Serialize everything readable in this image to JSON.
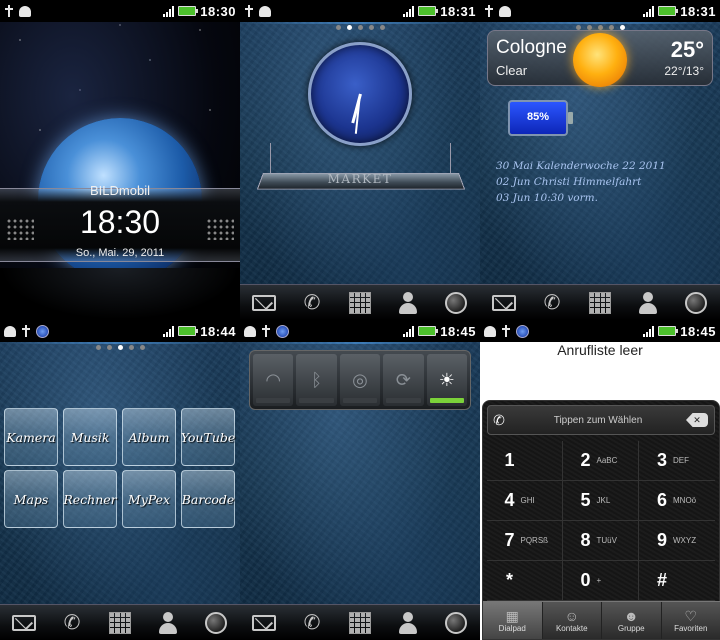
{
  "panels": {
    "lockscreen": {
      "time": "18:30",
      "carrier": "BILDmobil",
      "clock": "18:30",
      "date": "So., Mai. 29, 2011"
    },
    "home_clock": {
      "time": "18:31",
      "market_label": "MARKET"
    },
    "home_weather": {
      "time": "18:31",
      "weather": {
        "city": "Cologne",
        "condition": "Clear",
        "temp": "25°",
        "range": "22°/13°"
      },
      "battery": {
        "level": "85%",
        "fraction": 0.85
      },
      "calendar": [
        "30 Mai Kalenderwoche 22 2011",
        "02 Jun Christi Himmelfahrt",
        "03 Jun 10:30 vorm."
      ]
    },
    "home_apps": {
      "time": "18:44",
      "apps": [
        "Kamera",
        "Musik",
        "Album",
        "YouTube",
        "Maps",
        "Rechner",
        "MyPex",
        "Barcode"
      ]
    },
    "home_power": {
      "time": "18:45",
      "toggles": [
        "wifi",
        "bluetooth",
        "gps",
        "sync",
        "brightness"
      ],
      "active_toggle": "brightness"
    },
    "dialer": {
      "time": "18:45",
      "empty_text": "Anrufliste leer",
      "hint": "Tippen zum Wählen",
      "keys": [
        {
          "num": "1",
          "sub": ""
        },
        {
          "num": "2",
          "sub": "AaBC"
        },
        {
          "num": "3",
          "sub": "DEF"
        },
        {
          "num": "4",
          "sub": "GHI"
        },
        {
          "num": "5",
          "sub": "JKL"
        },
        {
          "num": "6",
          "sub": "MNOö"
        },
        {
          "num": "7",
          "sub": "PQRSß"
        },
        {
          "num": "8",
          "sub": "TUüV"
        },
        {
          "num": "9",
          "sub": "WXYZ"
        },
        {
          "num": "*",
          "sub": ""
        },
        {
          "num": "0",
          "sub": "+"
        },
        {
          "num": "#",
          "sub": ""
        }
      ],
      "tabs": [
        "Dialpad",
        "Kontakte",
        "Gruppe",
        "Favoriten"
      ]
    }
  },
  "dock_icons": [
    "mail-icon",
    "phone-icon",
    "apps-grid-icon",
    "contacts-icon",
    "browser-globe-icon"
  ],
  "colors": {
    "accent_glow": "#3ca0ff",
    "battery_green": "#4cc02c",
    "toggle_on": "#7bd23a"
  }
}
